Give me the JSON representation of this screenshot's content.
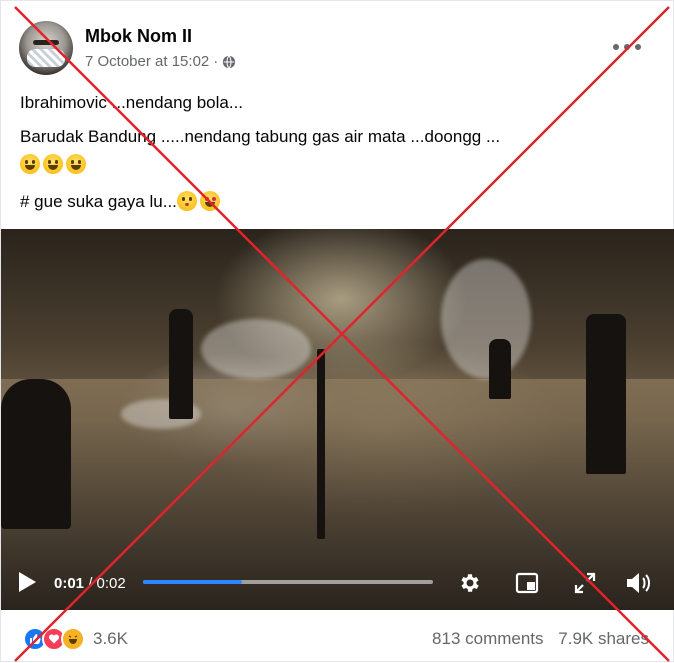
{
  "post": {
    "author": "Mbok Nom II",
    "timestamp": "7 October at 15:02",
    "meta_separator": "·",
    "privacy_icon": "globe-icon",
    "more_icon": "more-horizontal-icon",
    "lines": [
      "Ibrahimovic ...nendang  bola...",
      "Barudak Bandung .....nendang tabung gas air mata ...doongg ...",
      "# gue suka gaya lu..."
    ],
    "emoji_line_icons": [
      "grinning-face-icon",
      "grinning-face-icon",
      "grinning-face-icon"
    ],
    "line3_emojis": [
      "kissing-face-icon",
      "heart-eyes-face-icon"
    ]
  },
  "video": {
    "current_time": "0:01",
    "separator": "/",
    "duration": "0:02",
    "progress_fraction": 0.34,
    "icons": [
      "play-icon",
      "settings-icon",
      "picture-in-picture-icon",
      "fullscreen-icon",
      "volume-icon"
    ],
    "accent_color": "#2d88ff"
  },
  "footer": {
    "reaction_icons": [
      "like-icon",
      "love-icon",
      "haha-icon"
    ],
    "reaction_count": "3.6K",
    "comments": "813 comments",
    "shares": "7.9K shares"
  },
  "overlay": {
    "type": "red-x",
    "color": "#e0242c"
  }
}
